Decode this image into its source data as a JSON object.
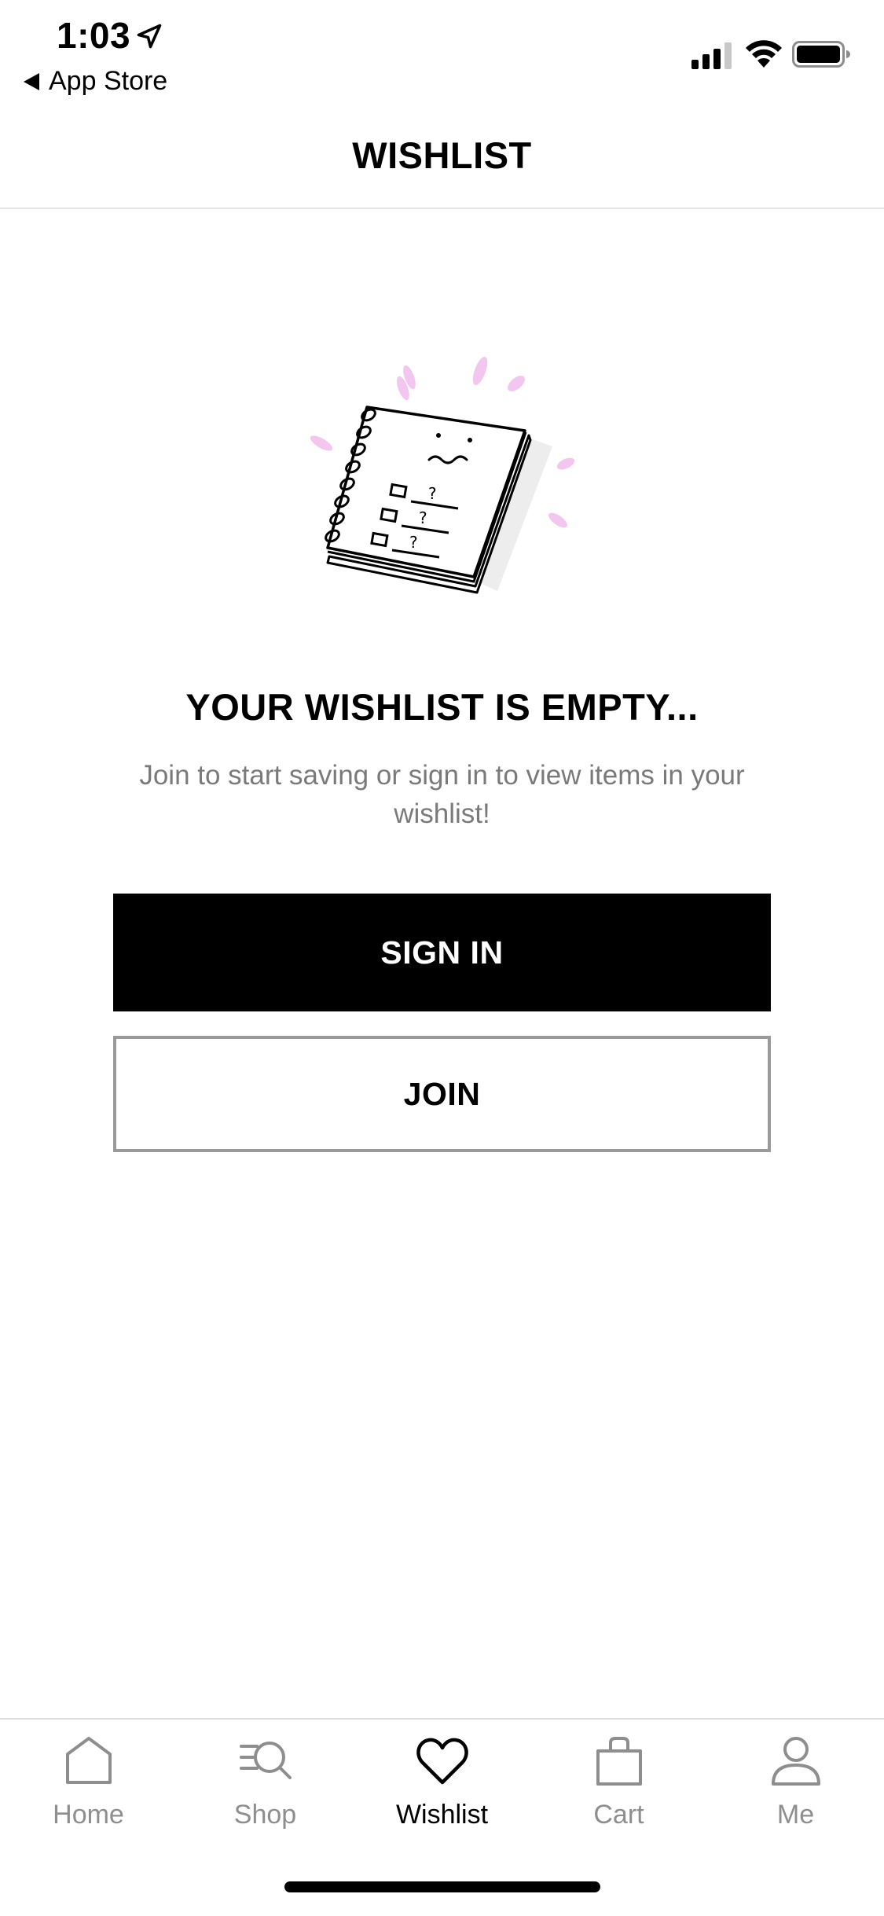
{
  "status_bar": {
    "time": "1:03",
    "back_app": "App Store"
  },
  "header": {
    "title": "WISHLIST"
  },
  "empty_state": {
    "title": "YOUR WISHLIST IS EMPTY...",
    "subtitle": "Join to start saving or sign in to view items in your wishlist!",
    "illustration": "notebook-illustration"
  },
  "actions": {
    "sign_in": "SIGN IN",
    "join": "JOIN"
  },
  "tab_bar": {
    "active": "Wishlist",
    "items": [
      {
        "label": "Home",
        "icon": "home-icon"
      },
      {
        "label": "Shop",
        "icon": "shop-search-icon"
      },
      {
        "label": "Wishlist",
        "icon": "heart-icon"
      },
      {
        "label": "Cart",
        "icon": "bag-icon"
      },
      {
        "label": "Me",
        "icon": "person-icon"
      }
    ]
  },
  "colors": {
    "primary": "#000000",
    "inactive_tab": "#8e8e8e",
    "subtitle": "#7a7a7a",
    "join_border": "#9a9a9a",
    "accent_sparkle": "#f3c6ef"
  }
}
